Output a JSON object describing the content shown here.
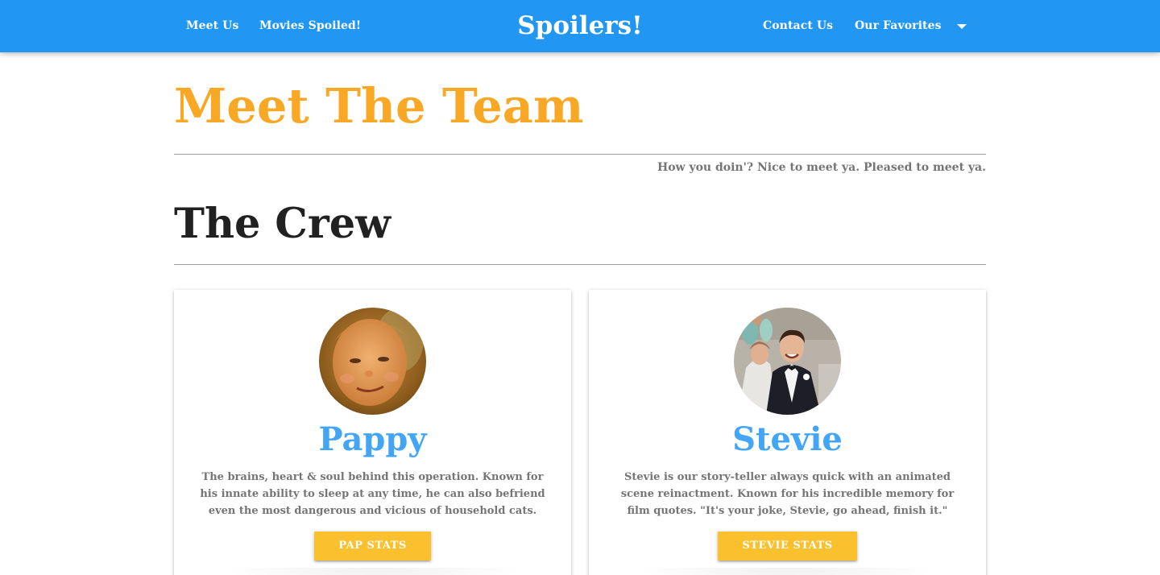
{
  "nav": {
    "left_links": [
      "Meet Us",
      "Movies Spoiled!"
    ],
    "brand": "Spoilers!",
    "right_links": [
      "Contact Us",
      "Our Favorites"
    ],
    "dropdown_icon": "caret-down-icon"
  },
  "header": {
    "title": "Meet The Team",
    "tagline": "How you doin'? Nice to meet ya. Pleased to meet ya."
  },
  "section": {
    "title": "The Crew"
  },
  "crew": [
    {
      "name": "Pappy",
      "description": "The brains, heart & soul behind this operation. Known for his innate ability to sleep at any time, he can also befriend even the most dangerous and vicious of household cats.",
      "button_label": "PAP STATS"
    },
    {
      "name": "Stevie",
      "description": "Stevie is our story-teller always quick with an animated scene reinactment. Known for his incredible memory for film quotes. \"It's your joke, Stevie, go ahead, finish it.\"",
      "button_label": "STEVIE STATS"
    }
  ],
  "colors": {
    "nav_bg": "#2196f3",
    "title": "#f9a825",
    "name": "#42a5f5",
    "button": "#fbc02d",
    "muted_text": "#757575"
  }
}
